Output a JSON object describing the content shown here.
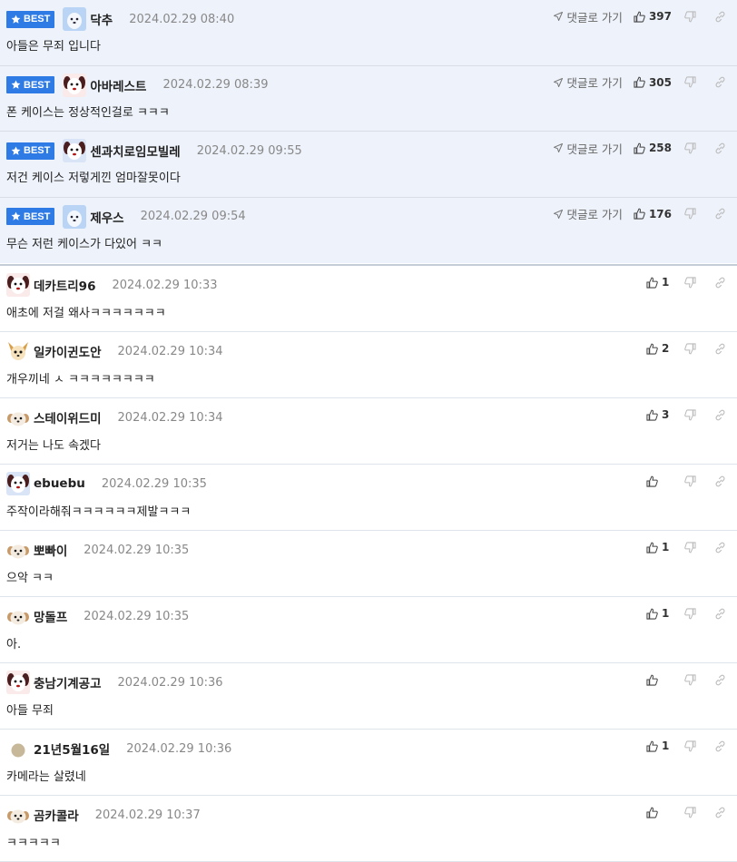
{
  "best_badge": "BEST",
  "reply_label": "댓글로 가기",
  "best_comments": [
    {
      "nick": "닥추",
      "date": "2024.02.29 08:40",
      "text": "아들은 무죄 입니다",
      "likes": "397",
      "avatar": "blue"
    },
    {
      "nick": "아바레스트",
      "date": "2024.02.29 08:39",
      "text": "폰 케이스는 정상적인걸로 ㅋㅋㅋ",
      "likes": "305",
      "avatar": "dog"
    },
    {
      "nick": "센과치로임모빌레",
      "date": "2024.02.29 09:55",
      "text": "저건 케이스 저렇게낀 엄마잘못이다",
      "likes": "258",
      "avatar": "dog2"
    },
    {
      "nick": "제우스",
      "date": "2024.02.29 09:54",
      "text": "무슨 저런 케이스가 다있어 ㅋㅋ",
      "likes": "176",
      "avatar": "blue"
    }
  ],
  "comments": [
    {
      "nick": "데카트리96",
      "date": "2024.02.29 10:33",
      "text": "애초에 저걸 왜사ㅋㅋㅋㅋㅋㅋㅋ",
      "likes": "1",
      "avatar": "dog"
    },
    {
      "nick": "일카이귄도안",
      "date": "2024.02.29 10:34",
      "text": "개우끼네 ㅅ ㅋㅋㅋㅋㅋㅋㅋㅋ",
      "likes": "2",
      "avatar": "chihuahua"
    },
    {
      "nick": "스테이위드미",
      "date": "2024.02.29 10:34",
      "text": "저거는 나도 속겠다",
      "likes": "3",
      "avatar": "puppy"
    },
    {
      "nick": "ebuebu",
      "date": "2024.02.29 10:35",
      "text": "주작이라해줘ㅋㅋㅋㅋㅋㅋ제발ㅋㅋㅋ",
      "likes": "",
      "avatar": "dog2"
    },
    {
      "nick": "뽀빠이",
      "date": "2024.02.29 10:35",
      "text": "으악 ㅋㅋ",
      "likes": "1",
      "avatar": "puppy"
    },
    {
      "nick": "망돌프",
      "date": "2024.02.29 10:35",
      "text": "아.",
      "likes": "1",
      "avatar": "puppy"
    },
    {
      "nick": "충남기계공고",
      "date": "2024.02.29 10:36",
      "text": "아들 무죄",
      "likes": "",
      "avatar": "dog"
    },
    {
      "nick": "21년5월16일",
      "date": "2024.02.29 10:36",
      "text": "카메라는 살렸네",
      "likes": "1",
      "avatar": "dot"
    },
    {
      "nick": "곰카콜라",
      "date": "2024.02.29 10:37",
      "text": "ㅋㅋㅋㅋㅋ",
      "likes": "",
      "avatar": "puppy"
    }
  ],
  "colors": {
    "badge": "#2e7be6",
    "best_bg": "#eef2fb"
  },
  "icons": [
    "star-icon",
    "reply-arrow-icon",
    "thumbs-up-icon",
    "thumbs-down-icon",
    "share-icon"
  ]
}
